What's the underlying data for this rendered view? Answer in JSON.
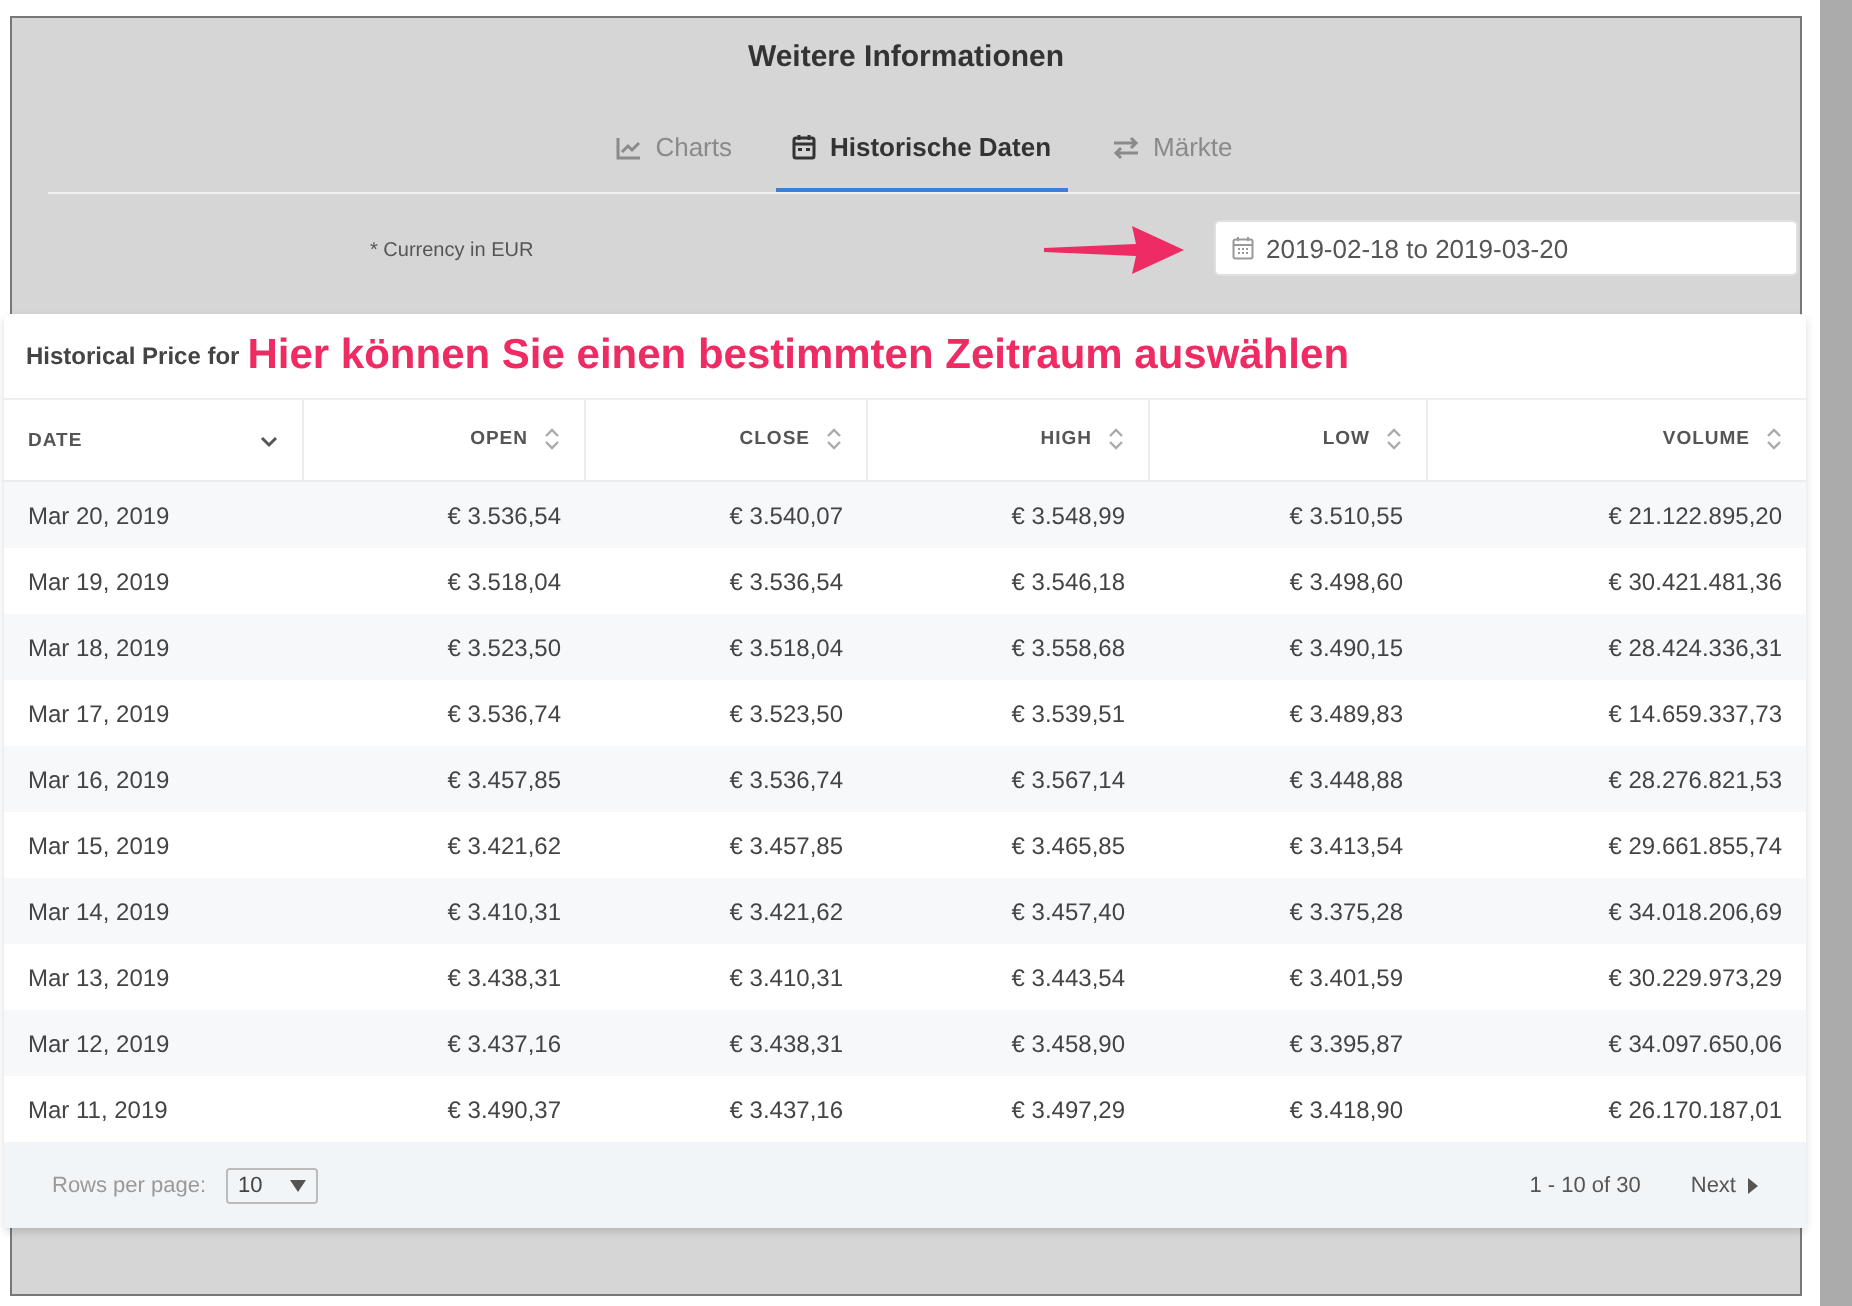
{
  "panel": {
    "title": "Weitere Informationen"
  },
  "tabs": [
    {
      "label": "Charts",
      "selected": false
    },
    {
      "label": "Historische Daten",
      "selected": true
    },
    {
      "label": "Märkte",
      "selected": false
    }
  ],
  "currency_note": "* Currency in EUR",
  "date_range": {
    "value": "2019-02-18 to 2019-03-20"
  },
  "annotation": "Hier können Sie einen bestimmten Zeitraum auswählen",
  "table": {
    "title": "Historical Price for",
    "columns": [
      {
        "label": "DATE",
        "kind": "sorted"
      },
      {
        "label": "OPEN",
        "kind": "sortable"
      },
      {
        "label": "CLOSE",
        "kind": "sortable"
      },
      {
        "label": "HIGH",
        "kind": "sortable"
      },
      {
        "label": "LOW",
        "kind": "sortable"
      },
      {
        "label": "VOLUME",
        "kind": "sortable"
      }
    ],
    "rows": [
      [
        "Mar 20, 2019",
        "€ 3.536,54",
        "€ 3.540,07",
        "€ 3.548,99",
        "€ 3.510,55",
        "€ 21.122.895,20"
      ],
      [
        "Mar 19, 2019",
        "€ 3.518,04",
        "€ 3.536,54",
        "€ 3.546,18",
        "€ 3.498,60",
        "€ 30.421.481,36"
      ],
      [
        "Mar 18, 2019",
        "€ 3.523,50",
        "€ 3.518,04",
        "€ 3.558,68",
        "€ 3.490,15",
        "€ 28.424.336,31"
      ],
      [
        "Mar 17, 2019",
        "€ 3.536,74",
        "€ 3.523,50",
        "€ 3.539,51",
        "€ 3.489,83",
        "€ 14.659.337,73"
      ],
      [
        "Mar 16, 2019",
        "€ 3.457,85",
        "€ 3.536,74",
        "€ 3.567,14",
        "€ 3.448,88",
        "€ 28.276.821,53"
      ],
      [
        "Mar 15, 2019",
        "€ 3.421,62",
        "€ 3.457,85",
        "€ 3.465,85",
        "€ 3.413,54",
        "€ 29.661.855,74"
      ],
      [
        "Mar 14, 2019",
        "€ 3.410,31",
        "€ 3.421,62",
        "€ 3.457,40",
        "€ 3.375,28",
        "€ 34.018.206,69"
      ],
      [
        "Mar 13, 2019",
        "€ 3.438,31",
        "€ 3.410,31",
        "€ 3.443,54",
        "€ 3.401,59",
        "€ 30.229.973,29"
      ],
      [
        "Mar 12, 2019",
        "€ 3.437,16",
        "€ 3.438,31",
        "€ 3.458,90",
        "€ 3.395,87",
        "€ 34.097.650,06"
      ],
      [
        "Mar 11, 2019",
        "€ 3.490,37",
        "€ 3.437,16",
        "€ 3.497,29",
        "€ 3.418,90",
        "€ 26.170.187,01"
      ]
    ]
  },
  "pagination": {
    "rows_label": "Rows per page:",
    "rows_value": "10",
    "range": "1 - 10 of 30",
    "next": "Next"
  }
}
